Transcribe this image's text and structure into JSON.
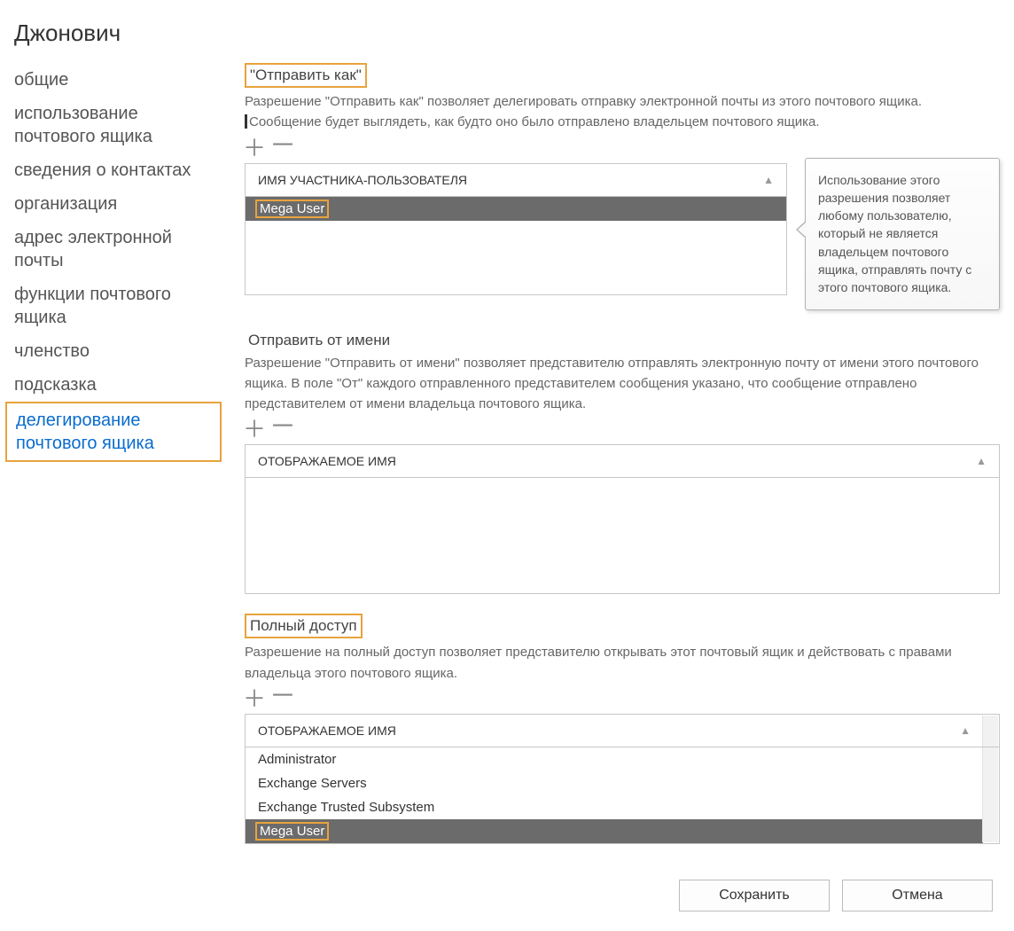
{
  "page_title": "Джонович",
  "sidebar": {
    "items": [
      {
        "label": "общие"
      },
      {
        "label": "использование почтового ящика"
      },
      {
        "label": "сведения о контактах"
      },
      {
        "label": "организация"
      },
      {
        "label": "адрес электронной почты"
      },
      {
        "label": "функции почтового ящика"
      },
      {
        "label": "членство"
      },
      {
        "label": "подсказка"
      },
      {
        "label": "делегирование почтового ящика",
        "active": true
      }
    ]
  },
  "send_as": {
    "title": "\"Отправить как\"",
    "description_line1": "Разрешение \"Отправить как\" позволяет делегировать отправку электронной почты из этого почтового ящика.",
    "description_line2": "Сообщение будет выглядеть, как будто оно было отправлено   владельцем почтового ящика.",
    "column_header": "ИМЯ УЧАСТНИКА-ПОЛЬЗОВАТЕЛЯ",
    "rows": [
      {
        "label": "Mega User",
        "selected": true
      }
    ],
    "tooltip": "Использование этого разрешения позволяет любому пользователю, который не является владельцем почтового ящика, отправлять почту с этого почтового ящика."
  },
  "send_on_behalf": {
    "title": "Отправить от имени",
    "description": "Разрешение \"Отправить от имени\" позволяет представителю отправлять электронную почту от имени этого почтового ящика. В поле \"От\" каждого отправленного представителем сообщения указано, что сообщение отправлено представителем от имени владельца почтового ящика.",
    "column_header": "ОТОБРАЖАЕМОЕ ИМЯ",
    "rows": []
  },
  "full_access": {
    "title": "Полный доступ",
    "description": "Разрешение на полный доступ позволяет представителю открывать этот почтовый ящик и действовать с правами владельца этого почтового ящика.",
    "column_header": "ОТОБРАЖАЕМОЕ ИМЯ",
    "rows": [
      {
        "label": "Administrator"
      },
      {
        "label": "Exchange Servers"
      },
      {
        "label": "Exchange Trusted Subsystem"
      },
      {
        "label": "Mega User",
        "selected": true
      }
    ]
  },
  "footer": {
    "save": "Сохранить",
    "cancel": "Отмена"
  },
  "icons": {
    "add": "＋",
    "remove": "－",
    "sort_asc": "▲"
  }
}
